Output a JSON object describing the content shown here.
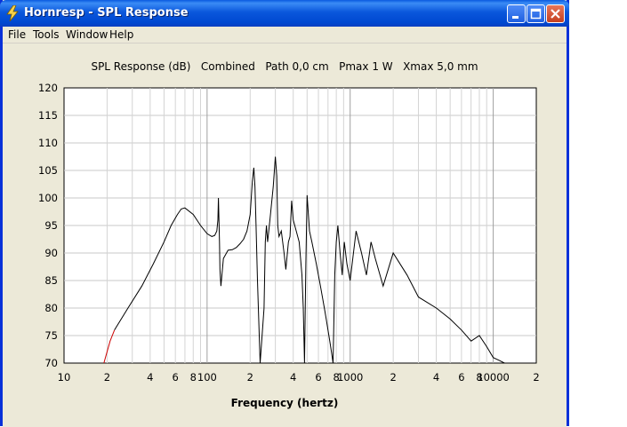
{
  "window": {
    "title": "Hornresp - SPL Response",
    "buttons": [
      "minimize",
      "maximize",
      "close"
    ]
  },
  "menu": {
    "items": [
      {
        "label": "File"
      },
      {
        "label": "Tools"
      },
      {
        "label": "Window"
      },
      {
        "label": "Help"
      }
    ]
  },
  "chart": {
    "title": "SPL Response (dB)   Combined   Path 0,0 cm   Pmax 1 W   Xmax 5,0 mm",
    "xlabel": "Frequency (hertz)"
  },
  "chart_data": {
    "type": "line",
    "xscale": "log",
    "xlim": [
      10,
      20000
    ],
    "ylim": [
      70,
      120
    ],
    "y_ticks": [
      "120",
      "115",
      "110",
      "105",
      "100",
      "95",
      "90",
      "85",
      "80",
      "75",
      "70"
    ],
    "x_ticks": [
      "10",
      "2",
      "4",
      "6",
      "8",
      "100",
      "2",
      "4",
      "6",
      "8",
      "1000",
      "2",
      "4",
      "6",
      "8",
      "10000",
      "2"
    ],
    "grid": true,
    "series": [
      {
        "segment": "red",
        "color": "#cc0000",
        "x": [
          19,
          21,
          22.5
        ],
        "y": [
          70,
          74,
          76
        ]
      },
      {
        "segment": "black",
        "color": "#000000",
        "x": [
          22.5,
          28,
          35,
          42,
          50,
          56,
          62,
          66,
          70,
          80,
          90,
          100,
          108,
          113,
          117,
          119,
          120,
          122,
          123,
          125,
          130,
          140,
          150,
          160,
          170,
          180,
          190,
          200,
          207,
          212,
          216,
          220,
          225,
          235,
          250,
          255,
          260,
          265,
          275,
          290,
          300,
          307,
          312,
          318,
          330,
          345,
          355,
          370,
          380,
          390,
          400,
          420,
          440,
          460,
          470,
          480,
          490,
          500,
          520,
          540,
          560,
          580,
          600,
          620,
          640,
          660,
          680,
          700,
          720,
          740,
          760,
          780,
          800,
          820,
          850,
          880,
          910,
          950,
          1000,
          1100,
          1200,
          1300,
          1400,
          1500,
          1700,
          2000,
          2500,
          3000,
          4000,
          5000,
          6000,
          7000,
          8000,
          9000,
          10000,
          11000,
          12000
        ],
        "y": [
          76,
          80,
          84,
          88,
          92,
          95,
          97,
          98,
          98.2,
          97,
          95,
          93.5,
          93,
          93.2,
          94,
          96,
          100,
          92,
          87,
          84,
          89,
          90.5,
          90.6,
          91,
          91.7,
          92.5,
          94,
          97,
          103,
          105.5,
          102,
          95,
          85,
          70,
          80,
          92,
          95,
          92,
          96,
          102,
          107.5,
          104,
          95,
          93,
          94,
          90,
          87,
          92,
          93,
          99.5,
          96,
          94,
          92,
          86,
          80,
          70,
          88,
          100.5,
          94,
          92,
          90,
          88,
          86,
          84,
          82,
          80,
          78,
          76,
          74,
          72,
          70,
          86,
          92,
          95,
          90,
          86,
          92,
          88,
          85,
          94,
          90,
          86,
          92,
          89,
          84,
          90,
          86,
          82,
          80,
          78,
          76,
          74,
          75,
          73,
          71,
          70.5,
          70
        ]
      }
    ]
  }
}
